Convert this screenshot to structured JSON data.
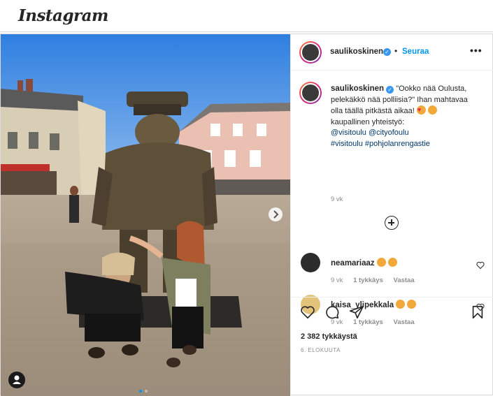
{
  "app": {
    "logo": "Instagram"
  },
  "post": {
    "author": "saulikoskinen",
    "follow_label": "Seuraa",
    "more_label": "•••",
    "caption": {
      "lines": [
        "\"Ookko nää Oulusta,",
        "pelekäkkö nää polliisia?\" Ihan mahtavaa",
        "olla täällä pitkästä aikaa!"
      ],
      "line4": "kaupallinen yhteistyö:",
      "mentions": "@visitoulu @cityofoulu",
      "hashtags": "#visitoulu #pohjolanrengastie",
      "time": "9 vk"
    },
    "comments": [
      {
        "user": "neamariaaz",
        "time": "9 vk",
        "likes": "1 tykkäys",
        "reply": "Vastaa"
      },
      {
        "user": "kaisa_ylipekkala",
        "time": "9 vk",
        "likes": "1 tykkäys",
        "reply": "Vastaa"
      }
    ],
    "likes_count": "2 382 tykkäystä",
    "date": "6. ELOKUUTA"
  },
  "colors": {
    "link": "#00376b",
    "follow": "#0095f6",
    "verified": "#3897f0",
    "heart": "#e0245e"
  },
  "icons": [
    "verified-icon",
    "more-icon",
    "add-comment-icon",
    "heart-icon",
    "comment-icon",
    "share-icon",
    "bookmark-icon",
    "next-arrow-icon",
    "user-tag-icon"
  ]
}
